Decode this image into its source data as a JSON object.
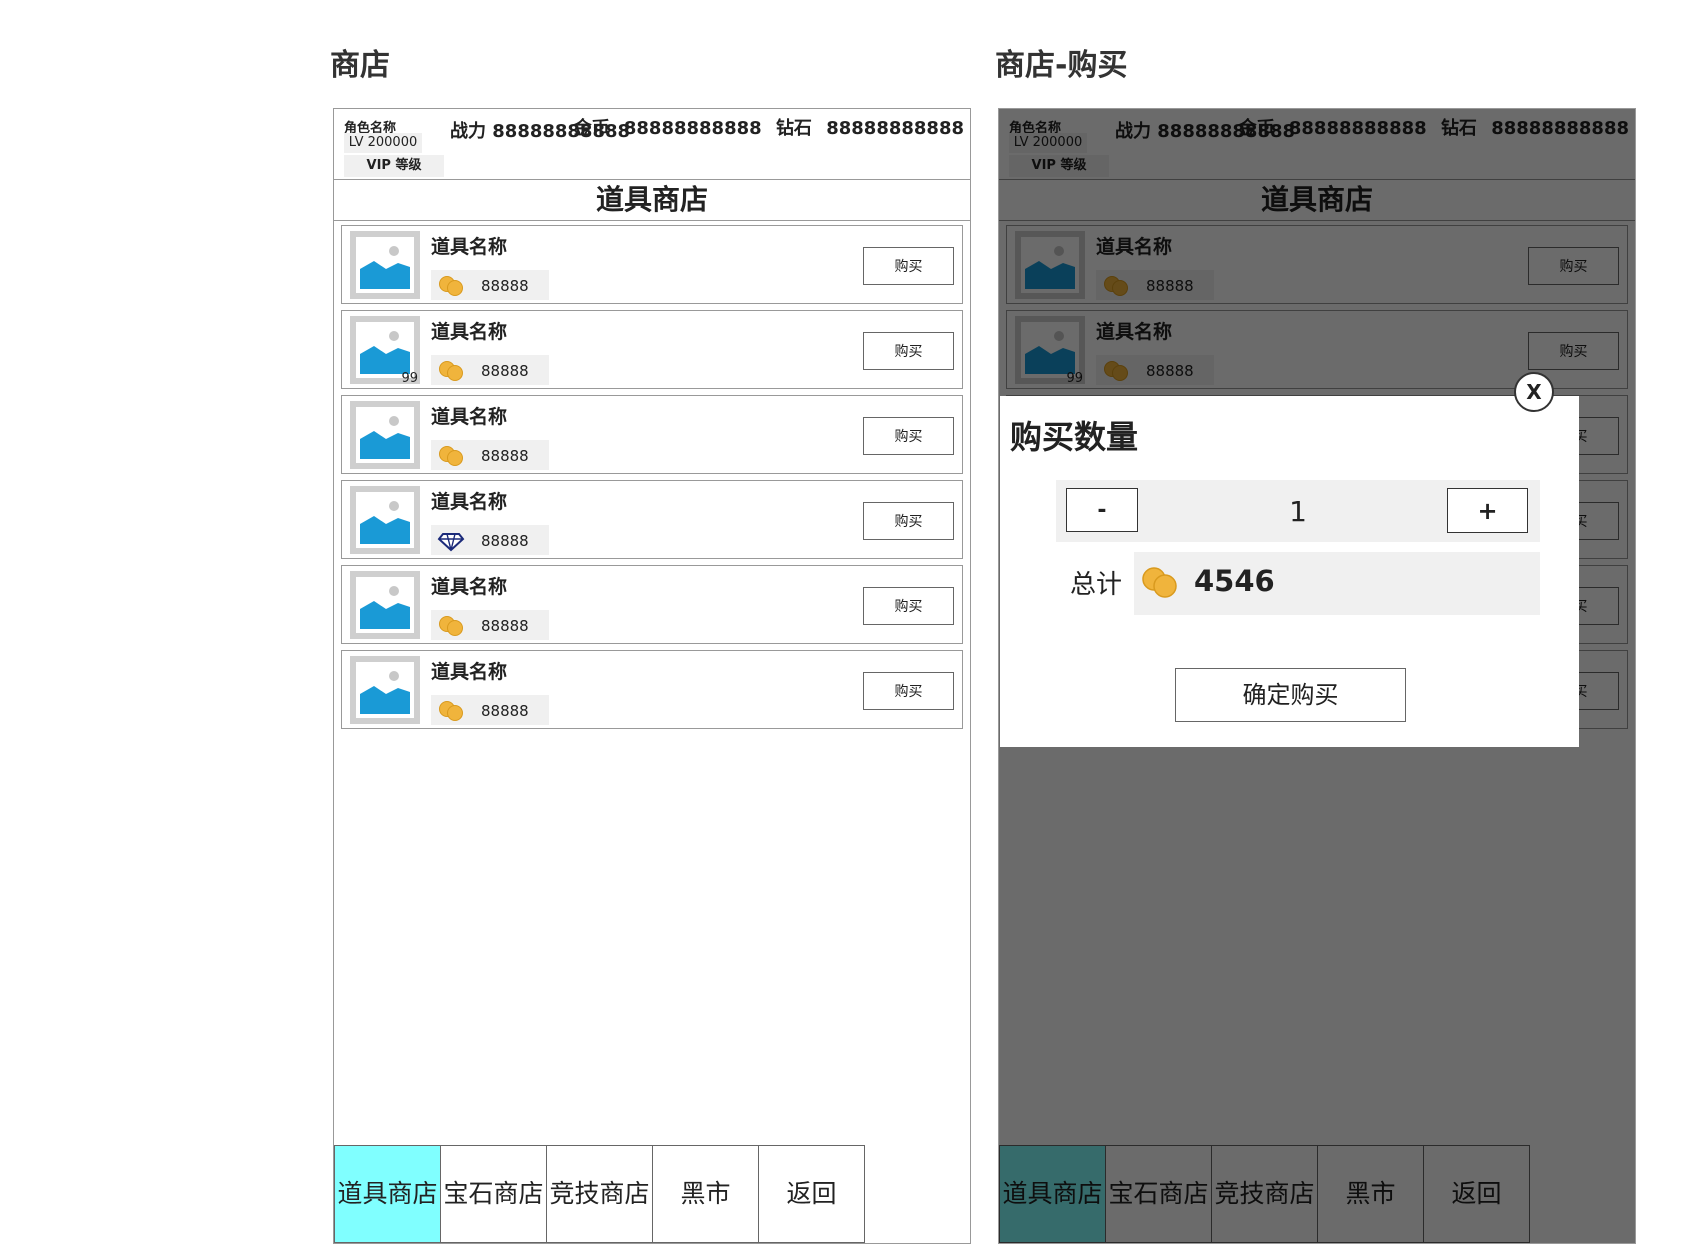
{
  "panels": {
    "shop": {
      "title": "商店"
    },
    "shop_buy": {
      "title": "商店-购买"
    }
  },
  "header": {
    "role_name": "角色名称",
    "level": "LV 200000",
    "vip": "VIP 等级",
    "power": "战力 88888888888",
    "gold_label": "金币",
    "gold_value": "88888888888",
    "diamond_label": "钻石",
    "diamond_value": "88888888888"
  },
  "shop_title": "道具商店",
  "items": [
    {
      "name": "道具名称",
      "price": "88888",
      "currency": "gold-coin-icon",
      "quantity": "",
      "buy_label": "购买"
    },
    {
      "name": "道具名称",
      "price": "88888",
      "currency": "gold-coin-icon",
      "quantity": "99",
      "buy_label": "购买"
    },
    {
      "name": "道具名称",
      "price": "88888",
      "currency": "gold-coin-icon",
      "quantity": "",
      "buy_label": "购买"
    },
    {
      "name": "道具名称",
      "price": "88888",
      "currency": "diamond-icon",
      "quantity": "",
      "buy_label": "购买"
    },
    {
      "name": "道具名称",
      "price": "88888",
      "currency": "gold-coin-icon",
      "quantity": "",
      "buy_label": "购买"
    },
    {
      "name": "道具名称",
      "price": "88888",
      "currency": "gold-coin-icon",
      "quantity": "",
      "buy_label": "购买"
    }
  ],
  "tabs": [
    {
      "label": "道具商店",
      "active": true
    },
    {
      "label": "宝石商店",
      "active": false
    },
    {
      "label": "竞技商店",
      "active": false
    },
    {
      "label": "黑市",
      "active": false
    },
    {
      "label": "返回",
      "active": false
    }
  ],
  "purchase_dialog": {
    "title": "购买数量",
    "close_label": "X",
    "minus_label": "-",
    "plus_label": "+",
    "quantity": "1",
    "total_label": "总计",
    "total_value": "4546",
    "confirm_label": "确定购买"
  },
  "colors": {
    "active_tab": "#80ffff",
    "image_placeholder": "#1a9ad6",
    "coin": "#f0b43c",
    "overlay": "rgba(0,0,0,0.58)"
  }
}
